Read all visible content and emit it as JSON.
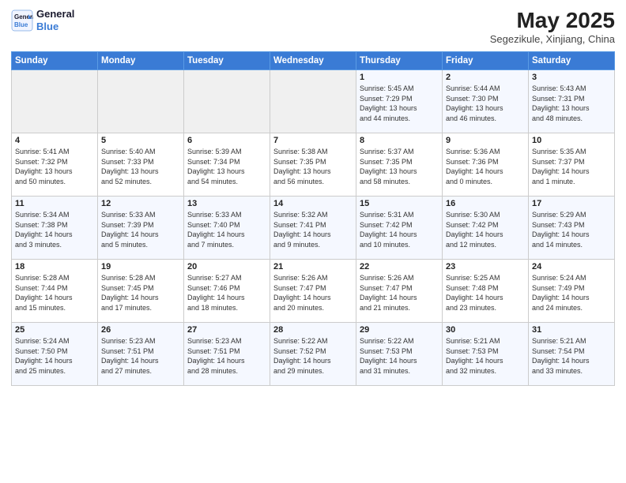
{
  "logo": {
    "line1": "General",
    "line2": "Blue"
  },
  "title": "May 2025",
  "location": "Segezikule, Xinjiang, China",
  "weekdays": [
    "Sunday",
    "Monday",
    "Tuesday",
    "Wednesday",
    "Thursday",
    "Friday",
    "Saturday"
  ],
  "weeks": [
    [
      {
        "day": "",
        "info": ""
      },
      {
        "day": "",
        "info": ""
      },
      {
        "day": "",
        "info": ""
      },
      {
        "day": "",
        "info": ""
      },
      {
        "day": "1",
        "info": "Sunrise: 5:45 AM\nSunset: 7:29 PM\nDaylight: 13 hours\nand 44 minutes."
      },
      {
        "day": "2",
        "info": "Sunrise: 5:44 AM\nSunset: 7:30 PM\nDaylight: 13 hours\nand 46 minutes."
      },
      {
        "day": "3",
        "info": "Sunrise: 5:43 AM\nSunset: 7:31 PM\nDaylight: 13 hours\nand 48 minutes."
      }
    ],
    [
      {
        "day": "4",
        "info": "Sunrise: 5:41 AM\nSunset: 7:32 PM\nDaylight: 13 hours\nand 50 minutes."
      },
      {
        "day": "5",
        "info": "Sunrise: 5:40 AM\nSunset: 7:33 PM\nDaylight: 13 hours\nand 52 minutes."
      },
      {
        "day": "6",
        "info": "Sunrise: 5:39 AM\nSunset: 7:34 PM\nDaylight: 13 hours\nand 54 minutes."
      },
      {
        "day": "7",
        "info": "Sunrise: 5:38 AM\nSunset: 7:35 PM\nDaylight: 13 hours\nand 56 minutes."
      },
      {
        "day": "8",
        "info": "Sunrise: 5:37 AM\nSunset: 7:35 PM\nDaylight: 13 hours\nand 58 minutes."
      },
      {
        "day": "9",
        "info": "Sunrise: 5:36 AM\nSunset: 7:36 PM\nDaylight: 14 hours\nand 0 minutes."
      },
      {
        "day": "10",
        "info": "Sunrise: 5:35 AM\nSunset: 7:37 PM\nDaylight: 14 hours\nand 1 minute."
      }
    ],
    [
      {
        "day": "11",
        "info": "Sunrise: 5:34 AM\nSunset: 7:38 PM\nDaylight: 14 hours\nand 3 minutes."
      },
      {
        "day": "12",
        "info": "Sunrise: 5:33 AM\nSunset: 7:39 PM\nDaylight: 14 hours\nand 5 minutes."
      },
      {
        "day": "13",
        "info": "Sunrise: 5:33 AM\nSunset: 7:40 PM\nDaylight: 14 hours\nand 7 minutes."
      },
      {
        "day": "14",
        "info": "Sunrise: 5:32 AM\nSunset: 7:41 PM\nDaylight: 14 hours\nand 9 minutes."
      },
      {
        "day": "15",
        "info": "Sunrise: 5:31 AM\nSunset: 7:42 PM\nDaylight: 14 hours\nand 10 minutes."
      },
      {
        "day": "16",
        "info": "Sunrise: 5:30 AM\nSunset: 7:42 PM\nDaylight: 14 hours\nand 12 minutes."
      },
      {
        "day": "17",
        "info": "Sunrise: 5:29 AM\nSunset: 7:43 PM\nDaylight: 14 hours\nand 14 minutes."
      }
    ],
    [
      {
        "day": "18",
        "info": "Sunrise: 5:28 AM\nSunset: 7:44 PM\nDaylight: 14 hours\nand 15 minutes."
      },
      {
        "day": "19",
        "info": "Sunrise: 5:28 AM\nSunset: 7:45 PM\nDaylight: 14 hours\nand 17 minutes."
      },
      {
        "day": "20",
        "info": "Sunrise: 5:27 AM\nSunset: 7:46 PM\nDaylight: 14 hours\nand 18 minutes."
      },
      {
        "day": "21",
        "info": "Sunrise: 5:26 AM\nSunset: 7:47 PM\nDaylight: 14 hours\nand 20 minutes."
      },
      {
        "day": "22",
        "info": "Sunrise: 5:26 AM\nSunset: 7:47 PM\nDaylight: 14 hours\nand 21 minutes."
      },
      {
        "day": "23",
        "info": "Sunrise: 5:25 AM\nSunset: 7:48 PM\nDaylight: 14 hours\nand 23 minutes."
      },
      {
        "day": "24",
        "info": "Sunrise: 5:24 AM\nSunset: 7:49 PM\nDaylight: 14 hours\nand 24 minutes."
      }
    ],
    [
      {
        "day": "25",
        "info": "Sunrise: 5:24 AM\nSunset: 7:50 PM\nDaylight: 14 hours\nand 25 minutes."
      },
      {
        "day": "26",
        "info": "Sunrise: 5:23 AM\nSunset: 7:51 PM\nDaylight: 14 hours\nand 27 minutes."
      },
      {
        "day": "27",
        "info": "Sunrise: 5:23 AM\nSunset: 7:51 PM\nDaylight: 14 hours\nand 28 minutes."
      },
      {
        "day": "28",
        "info": "Sunrise: 5:22 AM\nSunset: 7:52 PM\nDaylight: 14 hours\nand 29 minutes."
      },
      {
        "day": "29",
        "info": "Sunrise: 5:22 AM\nSunset: 7:53 PM\nDaylight: 14 hours\nand 31 minutes."
      },
      {
        "day": "30",
        "info": "Sunrise: 5:21 AM\nSunset: 7:53 PM\nDaylight: 14 hours\nand 32 minutes."
      },
      {
        "day": "31",
        "info": "Sunrise: 5:21 AM\nSunset: 7:54 PM\nDaylight: 14 hours\nand 33 minutes."
      }
    ]
  ]
}
